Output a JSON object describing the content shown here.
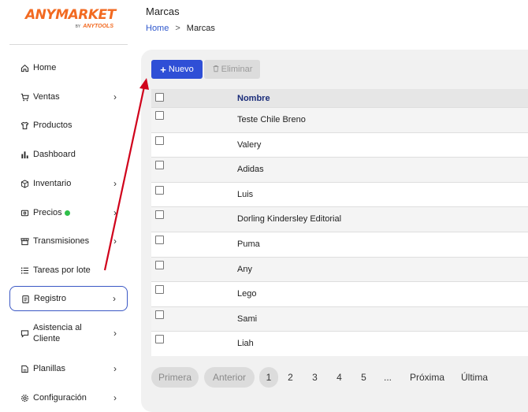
{
  "logo": {
    "main": "ANYMARKET",
    "by": "BY",
    "sub": "ANYTOOLS"
  },
  "sidebar": {
    "items": [
      {
        "label": "Home",
        "icon": "home-icon",
        "chevron": false
      },
      {
        "label": "Ventas",
        "icon": "cart-icon",
        "chevron": true
      },
      {
        "label": "Productos",
        "icon": "shirt-icon",
        "chevron": false
      },
      {
        "label": "Dashboard",
        "icon": "bar-chart-icon",
        "chevron": false
      },
      {
        "label": "Inventario",
        "icon": "box-icon",
        "chevron": true
      },
      {
        "label": "Precios",
        "icon": "tag-icon",
        "chevron": true,
        "badge_color": "#2fbf4a"
      },
      {
        "label": "Transmisiones",
        "icon": "store-icon",
        "chevron": true
      },
      {
        "label": "Tareas por lote",
        "icon": "list-icon",
        "chevron": false
      },
      {
        "label": "Registro",
        "icon": "clipboard-icon",
        "chevron": true,
        "active": true
      },
      {
        "label_line1": "Asistencia al",
        "label_line2": "Cliente",
        "icon": "chat-icon",
        "chevron": true
      },
      {
        "label": "Planillas",
        "icon": "spreadsheet-icon",
        "chevron": true
      },
      {
        "label": "Configuración",
        "icon": "gear-icon",
        "chevron": true
      }
    ]
  },
  "header": {
    "title": "Marcas",
    "breadcrumb_home": "Home",
    "breadcrumb_sep": ">",
    "breadcrumb_current": "Marcas"
  },
  "toolbar": {
    "new_label": "Nuevo",
    "delete_label": "Eliminar"
  },
  "table": {
    "column_header": "Nombre",
    "rows": [
      "Teste Chile Breno",
      "Valery",
      "Adidas",
      "Luis",
      "Dorling Kindersley Editorial",
      "Puma",
      "Any",
      "Lego",
      "Sami",
      "Liah"
    ]
  },
  "pagination": {
    "first": "Primera",
    "prev": "Anterior",
    "pages": [
      "1",
      "2",
      "3",
      "4",
      "5"
    ],
    "ellipsis": "...",
    "next": "Próxima",
    "last": "Última",
    "current_page": "1"
  },
  "colors": {
    "brand": "#f26a21",
    "primary_button": "#2f4fd6",
    "annotation_arrow": "#d0021b",
    "active_border": "#3a57c4"
  }
}
